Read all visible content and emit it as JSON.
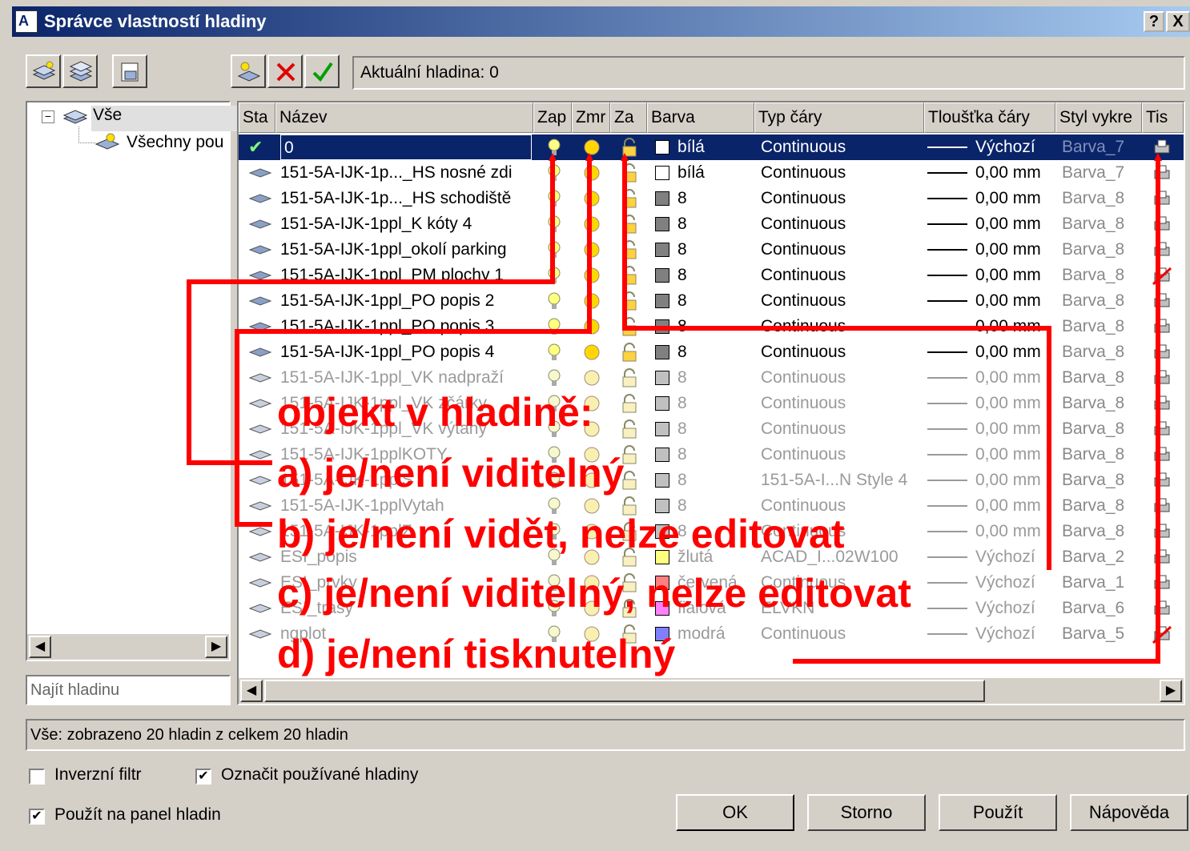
{
  "window": {
    "title": "Správce vlastností hladiny",
    "help_btn": "?",
    "close_btn": "X",
    "current_layer": "Aktuální hladina: 0"
  },
  "tree": {
    "root": "Vše",
    "child": "Všechny pou"
  },
  "search": {
    "placeholder": "Najít hladinu"
  },
  "columns": [
    "Sta",
    "Název",
    "Zap",
    "Zmr",
    "Za",
    "Barva",
    "Typ čáry",
    "Tloušťka čáry",
    "Styl vykre",
    "Tis"
  ],
  "layers": [
    {
      "name": "0",
      "color": "bílá",
      "color_hex": "#ffffff",
      "linetype": "Continuous",
      "lineweight": "Výchozí",
      "plotstyle": "Barva_7",
      "dim": false,
      "plot": true
    },
    {
      "name": "151-5A-IJK-1p..._HS nosné zdi",
      "color": "bílá",
      "color_hex": "#ffffff",
      "linetype": "Continuous",
      "lineweight": "0,00 mm",
      "plotstyle": "Barva_7",
      "dim": false,
      "plot": true
    },
    {
      "name": "151-5A-IJK-1p..._HS schodiště",
      "color": "8",
      "color_hex": "#808080",
      "linetype": "Continuous",
      "lineweight": "0,00 mm",
      "plotstyle": "Barva_8",
      "dim": false,
      "plot": true
    },
    {
      "name": "151-5A-IJK-1ppl_K kóty 4",
      "color": "8",
      "color_hex": "#808080",
      "linetype": "Continuous",
      "lineweight": "0,00 mm",
      "plotstyle": "Barva_8",
      "dim": false,
      "plot": true
    },
    {
      "name": "151-5A-IJK-1ppl_okolí parking",
      "color": "8",
      "color_hex": "#808080",
      "linetype": "Continuous",
      "lineweight": "0,00 mm",
      "plotstyle": "Barva_8",
      "dim": false,
      "plot": true
    },
    {
      "name": "151-5A-IJK-1ppl_PM plochy 1",
      "color": "8",
      "color_hex": "#808080",
      "linetype": "Continuous",
      "lineweight": "0,00 mm",
      "plotstyle": "Barva_8",
      "dim": false,
      "plot": false
    },
    {
      "name": "151-5A-IJK-1ppl_PO popis 2",
      "color": "8",
      "color_hex": "#808080",
      "linetype": "Continuous",
      "lineweight": "0,00 mm",
      "plotstyle": "Barva_8",
      "dim": false,
      "plot": true
    },
    {
      "name": "151-5A-IJK-1ppl_PO popis 3",
      "color": "8",
      "color_hex": "#808080",
      "linetype": "Continuous",
      "lineweight": "0,00 mm",
      "plotstyle": "Barva_8",
      "dim": false,
      "plot": true
    },
    {
      "name": "151-5A-IJK-1ppl_PO popis 4",
      "color": "8",
      "color_hex": "#808080",
      "linetype": "Continuous",
      "lineweight": "0,00 mm",
      "plotstyle": "Barva_8",
      "dim": false,
      "plot": true
    },
    {
      "name": "151-5A-IJK-1ppl_VK nadpraží",
      "color": "8",
      "color_hex": "#c0c0c0",
      "linetype": "Continuous",
      "lineweight": "0,00 mm",
      "plotstyle": "Barva_8",
      "dim": true,
      "plot": true
    },
    {
      "name": "151-5A-IJK-1ppl_VK zčárky",
      "color": "8",
      "color_hex": "#c0c0c0",
      "linetype": "Continuous",
      "lineweight": "0,00 mm",
      "plotstyle": "Barva_8",
      "dim": true,
      "plot": true
    },
    {
      "name": "151-5A-IJK-1ppl_VK výtahy",
      "color": "8",
      "color_hex": "#c0c0c0",
      "linetype": "Continuous",
      "lineweight": "0,00 mm",
      "plotstyle": "Barva_8",
      "dim": true,
      "plot": true
    },
    {
      "name": "151-5A-IJK-1pplKOTY",
      "color": "8",
      "color_hex": "#c0c0c0",
      "linetype": "Continuous",
      "lineweight": "0,00 mm",
      "plotstyle": "Barva_8",
      "dim": true,
      "plot": true
    },
    {
      "name": "151-5A-IJK-1pplS",
      "color": "8",
      "color_hex": "#c0c0c0",
      "linetype": "151-5A-I...N Style 4",
      "lineweight": "0,00 mm",
      "plotstyle": "Barva_8",
      "dim": true,
      "plot": true
    },
    {
      "name": "151-5A-IJK-1pplVytah",
      "color": "8",
      "color_hex": "#c0c0c0",
      "linetype": "Continuous",
      "lineweight": "0,00 mm",
      "plotstyle": "Barva_8",
      "dim": true,
      "plot": true
    },
    {
      "name": "151-5A-IJK-1pplZ",
      "color": "8",
      "color_hex": "#c0c0c0",
      "linetype": "Continuous",
      "lineweight": "0,00 mm",
      "plotstyle": "Barva_8",
      "dim": true,
      "plot": true
    },
    {
      "name": "ESI_popis",
      "color": "žlutá",
      "color_hex": "#ffff80",
      "linetype": "ACAD_I...02W100",
      "lineweight": "Výchozí",
      "plotstyle": "Barva_2",
      "dim": true,
      "plot": true
    },
    {
      "name": "ESI_prvky",
      "color": "červená",
      "color_hex": "#ff8080",
      "linetype": "Continuous",
      "lineweight": "Výchozí",
      "plotstyle": "Barva_1",
      "dim": true,
      "plot": true
    },
    {
      "name": "ESI_trasy",
      "color": "fialová",
      "color_hex": "#ff80ff",
      "linetype": "ELVKN",
      "lineweight": "Výchozí",
      "plotstyle": "Barva_6",
      "dim": true,
      "plot": true
    },
    {
      "name": "ngplot",
      "color": "modrá",
      "color_hex": "#8080ff",
      "linetype": "Continuous",
      "lineweight": "Výchozí",
      "plotstyle": "Barva_5",
      "dim": true,
      "plot": false
    }
  ],
  "status": "Vše: zobrazeno 20 hladin z celkem 20 hladin",
  "options": {
    "invert": "Inverzní filtr",
    "mark_used": "Označit používané hladiny",
    "apply_panel": "Použít na panel hladin"
  },
  "buttons": {
    "ok": "OK",
    "cancel": "Storno",
    "apply": "Použít",
    "help": "Nápověda"
  },
  "annotation": {
    "title": "objekt v hladině:",
    "a": "a) je/není viditelný",
    "b": "b) je/není vidět, nelze editovat",
    "c": "c) je/není viditelný, nelze editovat",
    "d": "d) je/není tisknutelný"
  },
  "colors": {
    "accent": "#0a246a",
    "annotation": "#ff0000"
  }
}
